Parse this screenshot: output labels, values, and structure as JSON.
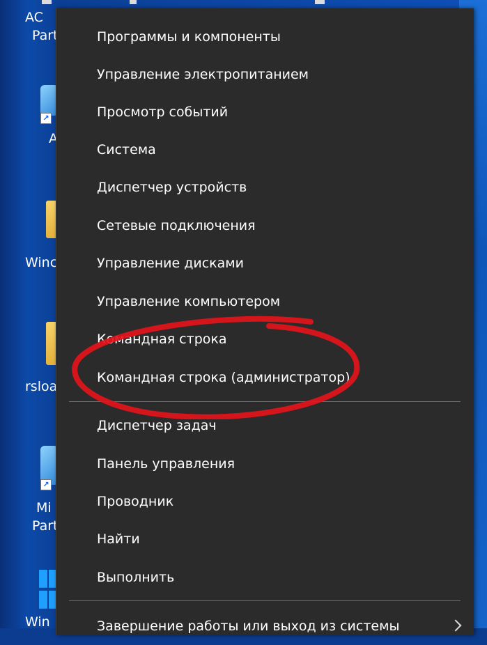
{
  "desktop": {
    "icon_labels": [
      "AC",
      "Part",
      "A",
      "Winc",
      "rsloa",
      "Mi",
      "Part",
      "Win"
    ]
  },
  "menu": {
    "items": [
      {
        "label": "Программы и компоненты"
      },
      {
        "label": "Управление электропитанием"
      },
      {
        "label": "Просмотр событий"
      },
      {
        "label": "Система"
      },
      {
        "label": "Диспетчер устройств"
      },
      {
        "label": "Сетевые подключения"
      },
      {
        "label": "Управление дисками"
      },
      {
        "label": "Управление компьютером"
      },
      {
        "label": "Командная строка"
      },
      {
        "label": "Командная строка (администратор)"
      }
    ],
    "items2": [
      {
        "label": "Диспетчер задач"
      },
      {
        "label": "Панель управления"
      },
      {
        "label": "Проводник"
      },
      {
        "label": "Найти"
      },
      {
        "label": "Выполнить"
      }
    ],
    "shutdown": {
      "label": "Завершение работы или выход из системы"
    }
  },
  "colors": {
    "menu_bg": "#2b2b2b",
    "menu_text": "#ffffff",
    "separator": "#6a6a6a",
    "highlight_ring": "#e3141b",
    "desktop_bg": "#0b3c8f"
  },
  "icons": [
    "folder-icon",
    "shortcut-arrow-icon",
    "windows-logo-icon",
    "chevron-right-icon"
  ]
}
